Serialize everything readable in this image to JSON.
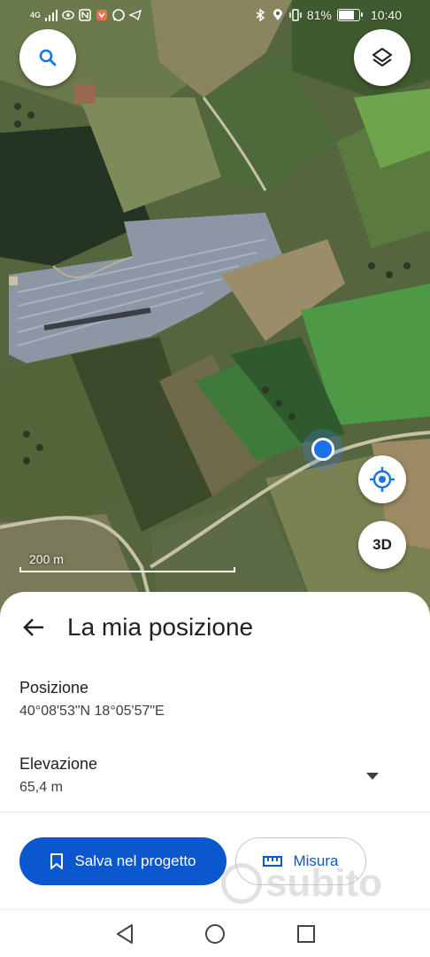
{
  "status_bar": {
    "network": "4G",
    "battery_percent": "81%",
    "battery_level": 0.81,
    "time": "10:40"
  },
  "map": {
    "scale_label": "200 m",
    "buttons": {
      "search_icon": "search-icon",
      "layers_icon": "layers-icon",
      "locate_icon": "my-location-icon",
      "view_3d_label": "3D"
    }
  },
  "sheet": {
    "title": "La mia posizione",
    "position_label": "Posizione",
    "position_value": "40°08'53\"N 18°05'57\"E",
    "elevation_label": "Elevazione",
    "elevation_value": "65,4 m",
    "save_button_label": "Salva nel progetto",
    "measure_button_label": "Misura"
  },
  "watermark": "subito",
  "colors": {
    "accent": "#0b57d0",
    "location_dot": "#1a73e8"
  }
}
